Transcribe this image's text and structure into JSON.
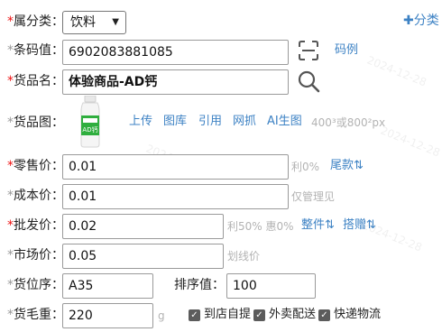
{
  "category": {
    "label": "属分类：",
    "selected": "饮料",
    "add_label": "✚分类"
  },
  "barcode": {
    "label": "条码值：",
    "value": "6902083881085",
    "example_link": "码例"
  },
  "product_name": {
    "label": "货品名：",
    "value": "体验商品-AD钙"
  },
  "product_image": {
    "label": "货品图：",
    "actions": [
      "上传",
      "图库",
      "引用",
      "网抓",
      "AI生图"
    ],
    "size_hint": "400³或800²px",
    "bottle_text": "AD钙"
  },
  "retail_price": {
    "label": "零售价：",
    "value": "0.01",
    "note": "利0%",
    "link": "尾款⇅"
  },
  "cost_price": {
    "label": "成本价：",
    "value": "0.01",
    "note": "仅管理见"
  },
  "wholesale_price": {
    "label": "批发价：",
    "value": "0.02",
    "note": "利50% 惠0%",
    "link1": "整件⇅",
    "link2": "搭赠⇅"
  },
  "market_price": {
    "label": "市场价：",
    "value": "0.05",
    "note": "划线价"
  },
  "shelf": {
    "label": "货位序：",
    "value": "A35",
    "sort_label": "排序值：",
    "sort_value": "100"
  },
  "weight": {
    "label": "货毛重：",
    "value": "220",
    "unit": "g",
    "options": [
      "到店自提",
      "外卖配送",
      "快递物流"
    ]
  },
  "colors": {
    "required": "#e11111",
    "link": "#3d82c4",
    "hint": "#b3b3b3"
  }
}
